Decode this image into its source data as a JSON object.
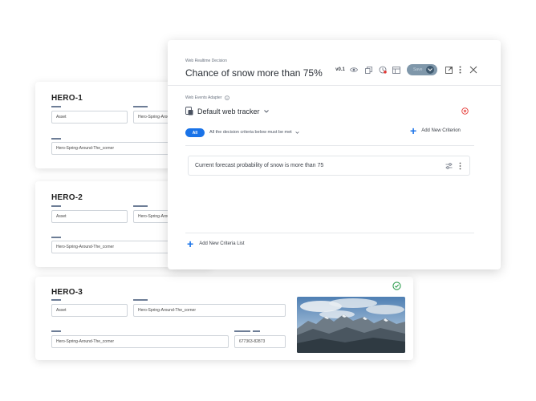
{
  "cards": [
    {
      "title": "HERO-1",
      "type_value": "Asset",
      "name_value": "Hero-Spring-Around-The_corner",
      "path_value": "Hero-Spring-Around-The_corner"
    },
    {
      "title": "HERO-2",
      "type_value": "Asset",
      "name_value": "Hero-Spring-Around-The_corner",
      "path_value": "Hero-Spring-Around-The_corner"
    },
    {
      "title": "HERO-3",
      "type_value": "Asset",
      "name_value": "Hero-Spring-Around-The_corner",
      "path_value": "Hero-Spring-Around-The_corner",
      "id_value": "677363-82873"
    }
  ],
  "panel": {
    "section_label": "Web Realtime Decision",
    "title": "Chance of snow more than 75%",
    "version": "v0.1",
    "save_label": "Save",
    "adapter_label": "Web Events Adapter",
    "adapter_name": "Default web tracker",
    "all_label": "All",
    "criteria_rule": "All the decision criteria below must be met",
    "add_criterion_label": "Add New Criterion",
    "criterion_text": "Current forecast probability of snow is more than 75",
    "add_list_label": "Add New Criteria List"
  },
  "colors": {
    "accent": "#1a73e8",
    "error": "#e53935",
    "success": "#2e9e4f"
  }
}
